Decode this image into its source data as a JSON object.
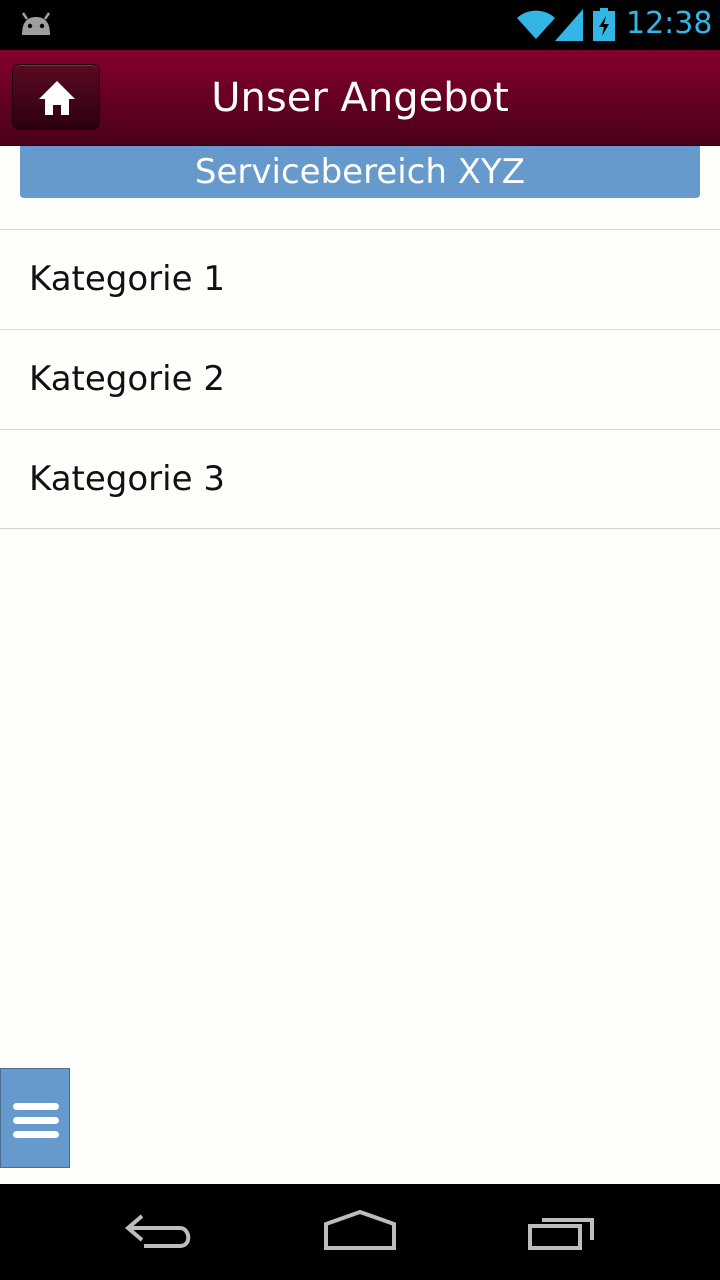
{
  "status_bar": {
    "time": "12:38",
    "icons": [
      "android-icon",
      "wifi-icon",
      "signal-icon",
      "battery-charging-icon"
    ],
    "accent_color": "#33b5e5"
  },
  "header": {
    "title": "Unser Angebot",
    "home_icon": "home-icon",
    "background_color": "#84002e"
  },
  "section": {
    "title": "Servicebereich XYZ",
    "color": "#6699cc"
  },
  "categories": [
    {
      "label": "Kategorie 1"
    },
    {
      "label": "Kategorie 2"
    },
    {
      "label": "Kategorie 3"
    }
  ],
  "menu_button": {
    "icon": "hamburger-menu-icon",
    "color": "#6699cc"
  },
  "nav_bar": {
    "icons": [
      "back-icon",
      "home-icon",
      "recent-apps-icon"
    ]
  }
}
